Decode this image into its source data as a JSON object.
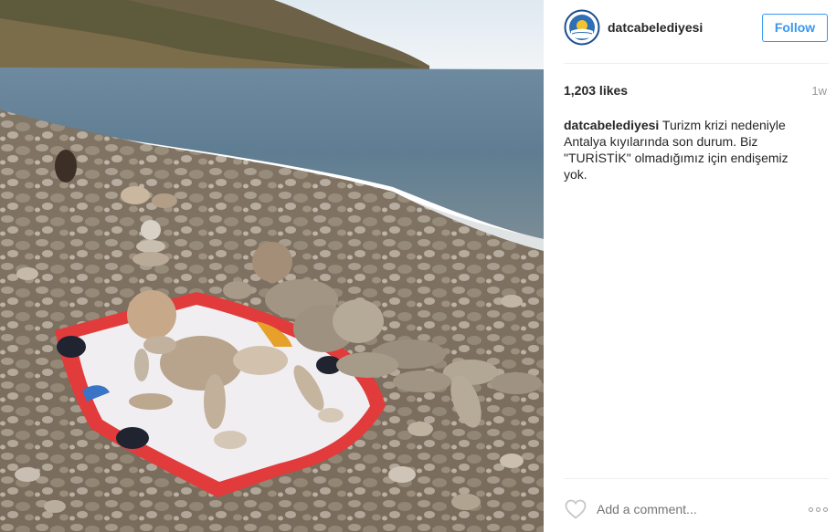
{
  "post": {
    "username": "datcabelediyesi",
    "follow_label": "Follow",
    "likes": "1,203 likes",
    "time_ago": "1w",
    "caption_user": "datcabelediyesi",
    "caption_text": "Turizm krizi nedeniyle Antalya kıyılarında son durum. Biz \"TURİSTİK\" olmadığımız için endişemiz yok.",
    "comment_placeholder": "Add a comment..."
  },
  "icons": {
    "avatar": "municipality-logo-icon",
    "like": "heart-icon",
    "more": "more-options-icon"
  },
  "colors": {
    "accent": "#3897f0",
    "text": "#262626",
    "muted": "#999999"
  }
}
